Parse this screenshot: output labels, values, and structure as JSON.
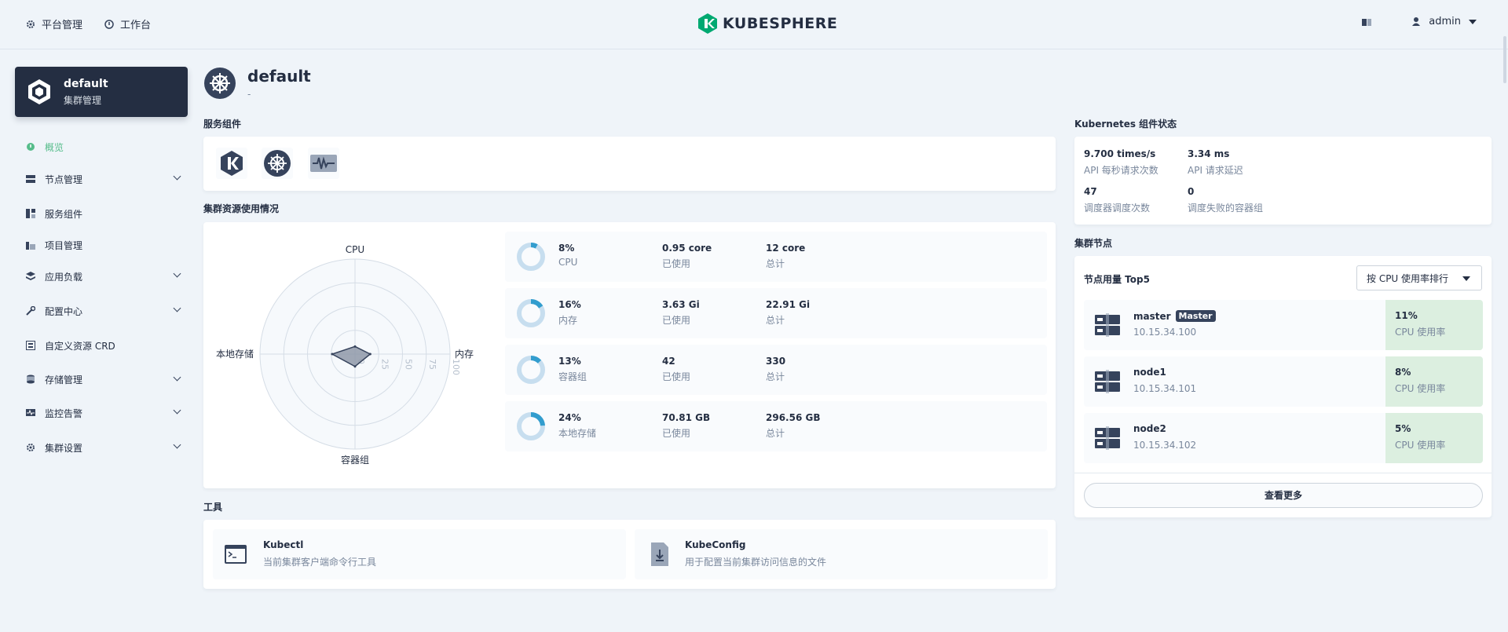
{
  "topbar": {
    "platform_label": "平台管理",
    "workbench_label": "工作台",
    "logo_text": "KUBESPHERE",
    "user_name": "admin"
  },
  "cluster": {
    "name": "default",
    "subtitle": "集群管理"
  },
  "sidebar": {
    "items": [
      {
        "label": "概览",
        "icon": "overview-icon",
        "active": true,
        "expandable": false
      },
      {
        "label": "节点管理",
        "icon": "nodes-icon",
        "expandable": true
      },
      {
        "label": "服务组件",
        "icon": "components-icon",
        "expandable": false
      },
      {
        "label": "项目管理",
        "icon": "project-icon",
        "expandable": false
      },
      {
        "label": "应用负载",
        "icon": "workload-icon",
        "expandable": true
      },
      {
        "label": "配置中心",
        "icon": "config-icon",
        "expandable": true
      },
      {
        "label": "自定义资源 CRD",
        "icon": "crd-icon",
        "expandable": false
      },
      {
        "label": "存储管理",
        "icon": "storage-icon",
        "expandable": true
      },
      {
        "label": "监控告警",
        "icon": "monitor-icon",
        "expandable": true
      },
      {
        "label": "集群设置",
        "icon": "settings-icon",
        "expandable": true
      }
    ]
  },
  "page": {
    "title": "default",
    "subtitle": "-"
  },
  "sections": {
    "service_components": "服务组件",
    "cluster_usage": "集群资源使用情况",
    "tools": "工具",
    "k8s_status": "Kubernetes 组件状态",
    "cluster_nodes": "集群节点"
  },
  "radar": {
    "axes": [
      "CPU",
      "内存",
      "容器组",
      "本地存储"
    ],
    "ticks": [
      "0",
      "25",
      "50",
      "75",
      "100"
    ],
    "values_percent": [
      8,
      16,
      13,
      24
    ]
  },
  "resources": [
    {
      "percent": "8%",
      "percent_value": 8,
      "name": "CPU",
      "used": "0.95 core",
      "used_label": "已使用",
      "total": "12 core",
      "total_label": "总计"
    },
    {
      "percent": "16%",
      "percent_value": 16,
      "name": "内存",
      "used": "3.63 Gi",
      "used_label": "已使用",
      "total": "22.91 Gi",
      "total_label": "总计"
    },
    {
      "percent": "13%",
      "percent_value": 13,
      "name": "容器组",
      "used": "42",
      "used_label": "已使用",
      "total": "330",
      "total_label": "总计"
    },
    {
      "percent": "24%",
      "percent_value": 24,
      "name": "本地存储",
      "used": "70.81 GB",
      "used_label": "已使用",
      "total": "296.56 GB",
      "total_label": "总计"
    }
  ],
  "k8s": [
    {
      "value": "9.700 times/s",
      "label": "API 每秒请求次数"
    },
    {
      "value": "3.34 ms",
      "label": "API 请求延迟"
    },
    {
      "value": "47",
      "label": "调度器调度次数"
    },
    {
      "value": "0",
      "label": "调度失败的容器组"
    }
  ],
  "nodes": {
    "header": "节点用量 Top5",
    "sort_label": "按 CPU 使用率排行",
    "items": [
      {
        "name": "master",
        "badge": "Master",
        "ip": "10.15.34.100",
        "usage": "11%",
        "usage_label": "CPU 使用率"
      },
      {
        "name": "node1",
        "badge": "",
        "ip": "10.15.34.101",
        "usage": "8%",
        "usage_label": "CPU 使用率"
      },
      {
        "name": "node2",
        "badge": "",
        "ip": "10.15.34.102",
        "usage": "5%",
        "usage_label": "CPU 使用率"
      }
    ],
    "more_label": "查看更多"
  },
  "tools": [
    {
      "name": "Kubectl",
      "desc": "当前集群客户端命令行工具",
      "icon": "terminal-icon"
    },
    {
      "name": "KubeConfig",
      "desc": "用于配置当前集群访问信息的文件",
      "icon": "download-file-icon"
    }
  ],
  "colors": {
    "accent": "#55bc8a",
    "dark": "#242e42",
    "muted": "#79879c",
    "donut_fill": "#329dce",
    "donut_track": "#c7deef",
    "node_usage_bg": "#dcefe0"
  }
}
